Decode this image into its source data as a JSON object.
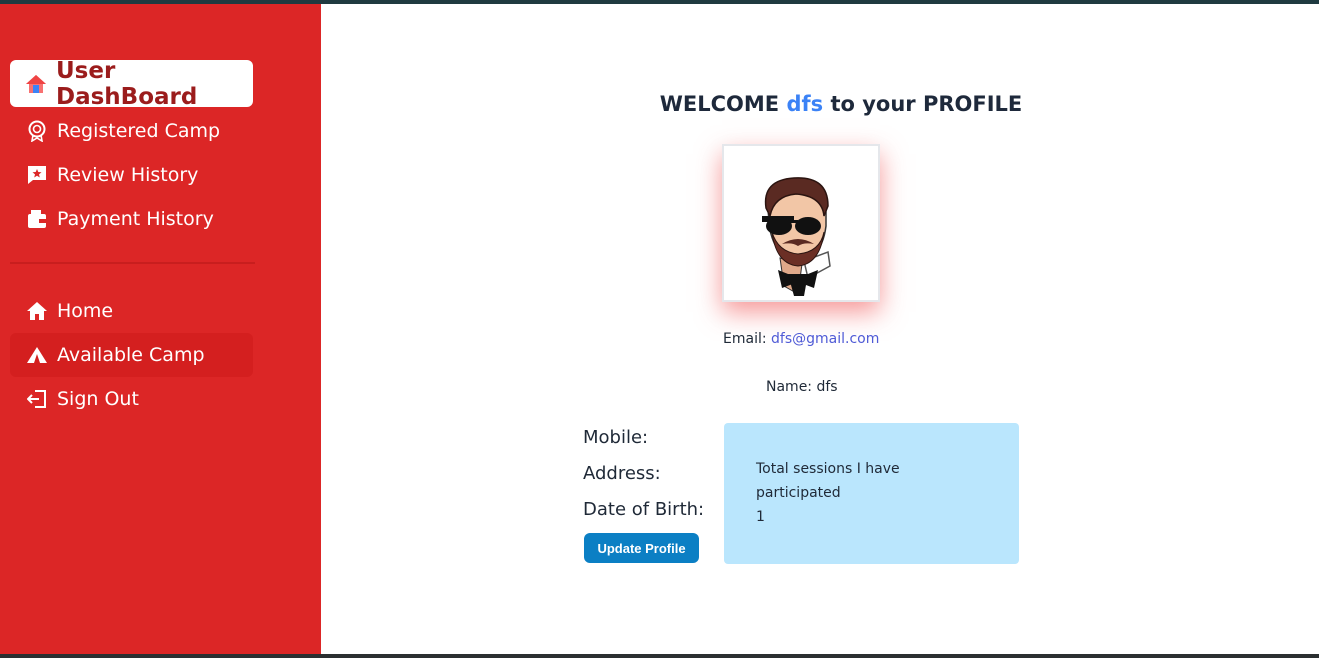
{
  "sidebar": {
    "items": [
      {
        "label": "User DashBoard",
        "icon": "home-colored-icon",
        "active": true
      },
      {
        "label": "Registered Camp",
        "icon": "badge-icon"
      },
      {
        "label": "Review History",
        "icon": "review-icon"
      },
      {
        "label": "Payment History",
        "icon": "wallet-icon"
      }
    ],
    "nav": [
      {
        "label": "Home",
        "icon": "home-icon"
      },
      {
        "label": "Available Camp",
        "icon": "tent-icon"
      },
      {
        "label": "Sign Out",
        "icon": "sign-out-icon"
      }
    ]
  },
  "profile": {
    "welcome_prefix": "WELCOME",
    "user_name": "dfs",
    "welcome_suffix": "to your PROFILE",
    "email_label": "Email:",
    "email": "dfs@gmail.com",
    "name_label": "Name:",
    "name": "dfs",
    "mobile_label": "Mobile:",
    "address_label": "Address:",
    "dob_label": "Date of Birth:",
    "update_button": "Update Profile",
    "sessions_label": "Total sessions I have participated",
    "sessions_count": "1"
  },
  "colors": {
    "sidebar_bg": "#dc2626",
    "accent_name": "#3b82f6",
    "button": "#0b7fc4",
    "sessions_bg": "#bae6fd"
  }
}
